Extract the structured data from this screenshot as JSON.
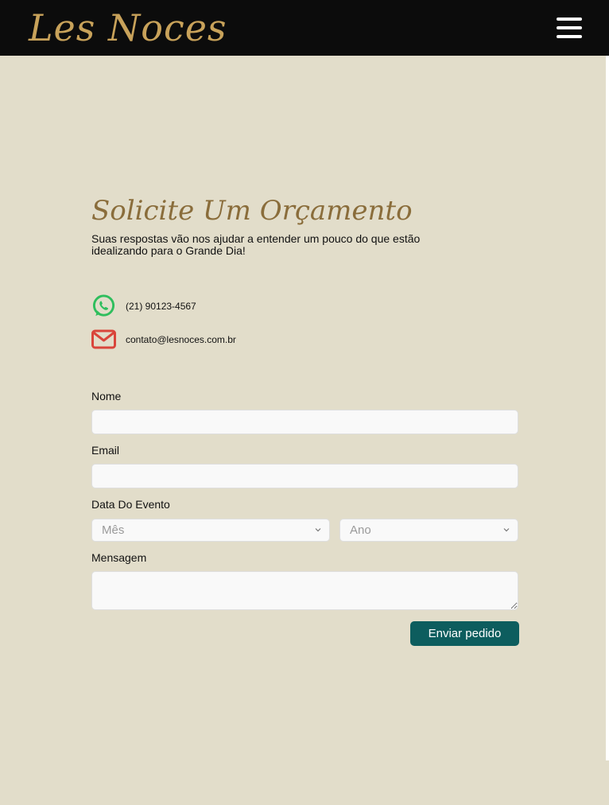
{
  "header": {
    "logo_text": "Les Noces",
    "menu_icon": "hamburger-menu-icon"
  },
  "colors": {
    "header_bg": "#0c0c0c",
    "page_bg": "#e2ddca",
    "logo": "#c8a25a",
    "title": "#8a6d3b",
    "button_bg": "#0d5d5e",
    "whatsapp": "#2fbe5d",
    "mail": "#d9453b"
  },
  "section": {
    "title": "Solicite Um Orçamento",
    "subtitle": "Suas respostas vão nos ajudar a entender um pouco do que estão idealizando para o Grande Dia!"
  },
  "contacts": {
    "phone": {
      "icon": "whatsapp-icon",
      "text": "(21) 90123-4567"
    },
    "email": {
      "icon": "envelope-icon",
      "text": "contato@lesnoces.com.br"
    }
  },
  "form": {
    "nome": {
      "label": "Nome",
      "value": "",
      "placeholder": ""
    },
    "email": {
      "label": "Email",
      "value": "",
      "placeholder": ""
    },
    "data_evento": {
      "label": "Data Do Evento",
      "mes": {
        "selected": "Mês"
      },
      "ano": {
        "selected": "Ano"
      }
    },
    "mensagem": {
      "label": "Mensagem",
      "value": "",
      "placeholder": ""
    },
    "submit_label": "Enviar pedido"
  }
}
